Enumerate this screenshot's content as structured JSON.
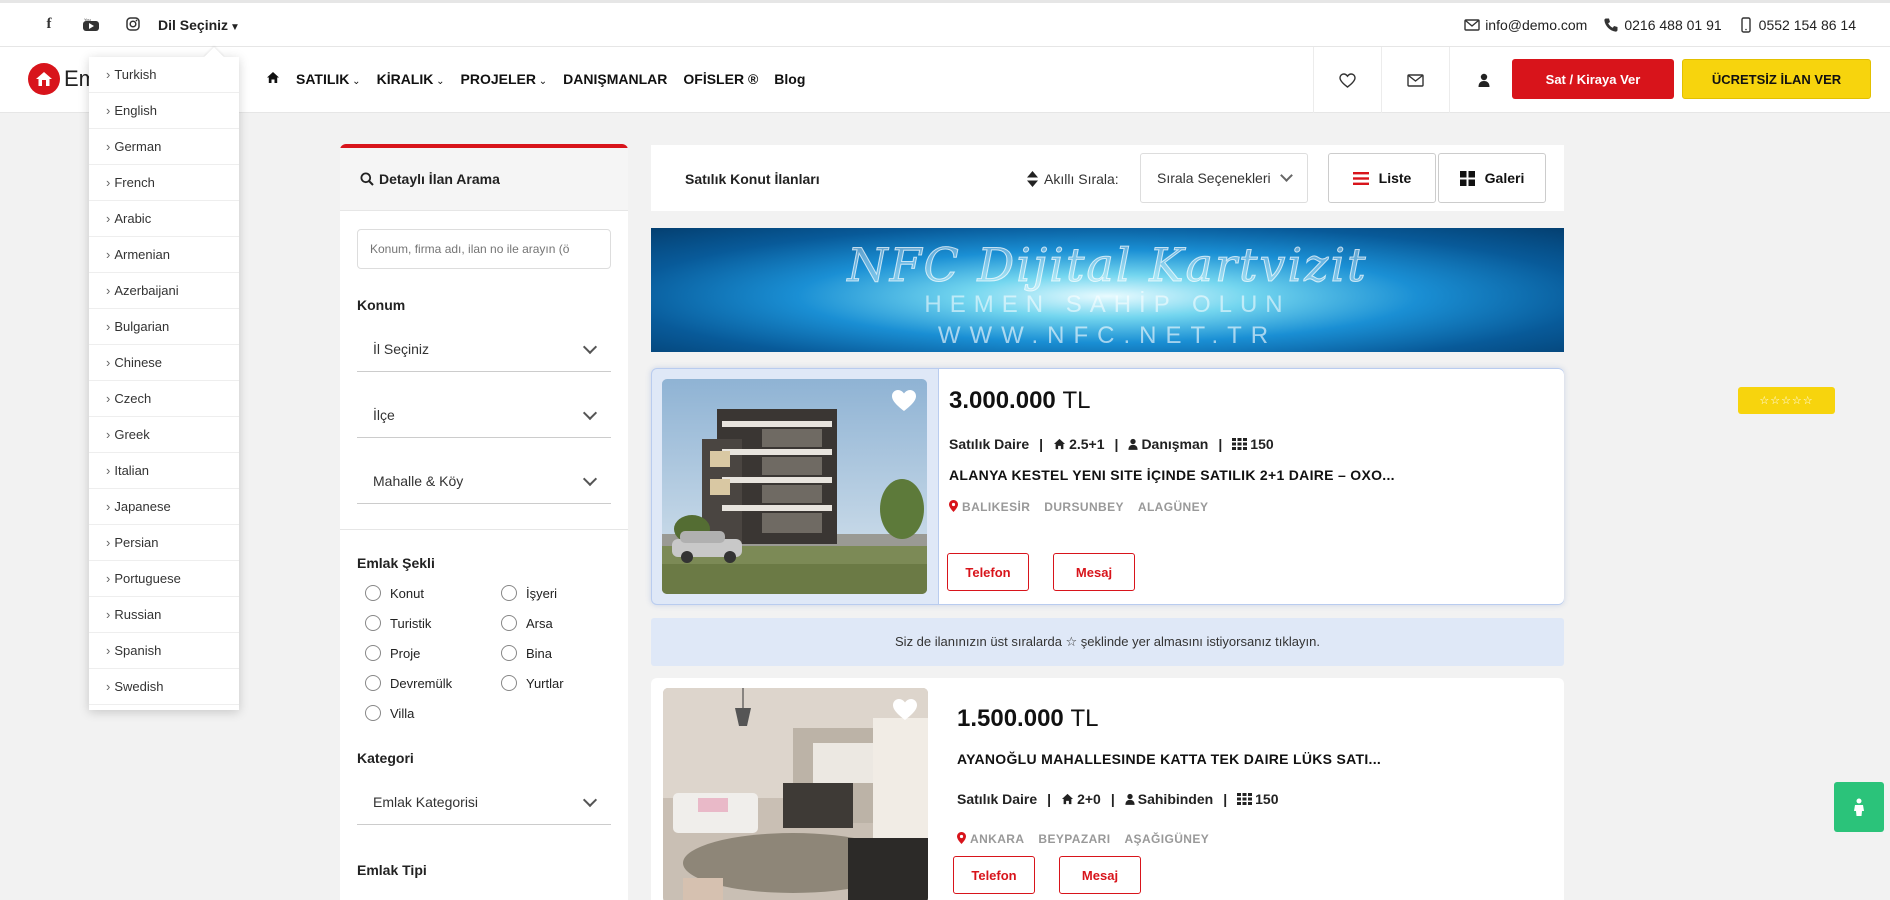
{
  "topbar": {
    "social": [
      {
        "name": "facebook",
        "glyph": "f"
      },
      {
        "name": "youtube",
        "glyph": "▶"
      },
      {
        "name": "instagram",
        "glyph": "◎"
      }
    ],
    "language_label": "Dil Seçiniz",
    "email": "info@demo.com",
    "phone": "0216 488 01 91",
    "mobile": "0552 154 86 14"
  },
  "navbar": {
    "logo_text": "Em",
    "menu": [
      "SATILIK",
      "KİRALIK",
      "PROJELER",
      "DANIŞMANLAR",
      "OFİSLER ®",
      "Blog"
    ],
    "sell_rent_button": "Sat / Kiraya Ver",
    "free_listing_button": "ÜCRETSİZ İLAN VER"
  },
  "language_dropdown": [
    "Turkish",
    "English",
    "German",
    "French",
    "Arabic",
    "Armenian",
    "Azerbaijani",
    "Bulgarian",
    "Chinese",
    "Czech",
    "Greek",
    "Italian",
    "Japanese",
    "Persian",
    "Portuguese",
    "Russian",
    "Spanish",
    "Swedish"
  ],
  "sidebar": {
    "title": "Detaylı İlan Arama",
    "search_placeholder": "Konum, firma adı, ilan no ile arayın (ö",
    "location_label": "Konum",
    "province": "İl Seçiniz",
    "district": "İlçe",
    "neighborhood": "Mahalle & Köy",
    "property_form_label": "Emlak Şekli",
    "property_forms": [
      "Konut",
      "İşyeri",
      "Turistik",
      "Arsa",
      "Proje",
      "Bina",
      "Devremülk",
      "Yurtlar",
      "Villa"
    ],
    "category_label": "Kategori",
    "category_select": "Emlak Kategorisi",
    "type_label": "Emlak Tipi"
  },
  "toolbar": {
    "title": "Satılık Konut İlanları",
    "smart_sort": "Akıllı Sırala:",
    "sort_select": "Sırala Seçenekleri",
    "list_button": "Liste",
    "gallery_button": "Galeri"
  },
  "banner": {
    "line1": "NFC Dijital Kartvizit",
    "line2": "HEMEN SAHİP OLUN",
    "line3": "WWW.NFC.NET.TR"
  },
  "listings": [
    {
      "price": "3.000.000",
      "currency": "TL",
      "type": "Satılık Daire",
      "rooms": "2.5+1",
      "owner": "Danışman",
      "area": "150",
      "title": "ALANYA KESTEL YENI SITE İÇINDE SATILIK 2+1 DAIRE – OXO...",
      "location": [
        "BALIKESİR",
        "DURSUNBEY",
        "ALAGÜNEY"
      ],
      "phone_button": "Telefon",
      "message_button": "Mesaj",
      "featured_stars": "☆☆☆☆☆"
    },
    {
      "price": "1.500.000",
      "currency": "TL",
      "type": "Satılık Daire",
      "rooms": "2+0",
      "owner": "Sahibinden",
      "area": "150",
      "title": "AYANOĞLU MAHALLESINDE KATTA TEK DAIRE LÜKS SATI...",
      "location": [
        "ANKARA",
        "BEYPAZARI",
        "AŞAĞIGÜNEY"
      ],
      "phone_button": "Telefon",
      "message_button": "Mesaj"
    }
  ],
  "notice": "Siz de ilanınızın üst sıralarda ☆ şeklinde yer almasını istiyorsanız tıklayın.",
  "colors": {
    "brand_red": "#d8141b",
    "brand_yellow": "#f7d40d",
    "scroll_green": "#2bc37a",
    "highlight_blue": "#dfe8f7"
  }
}
